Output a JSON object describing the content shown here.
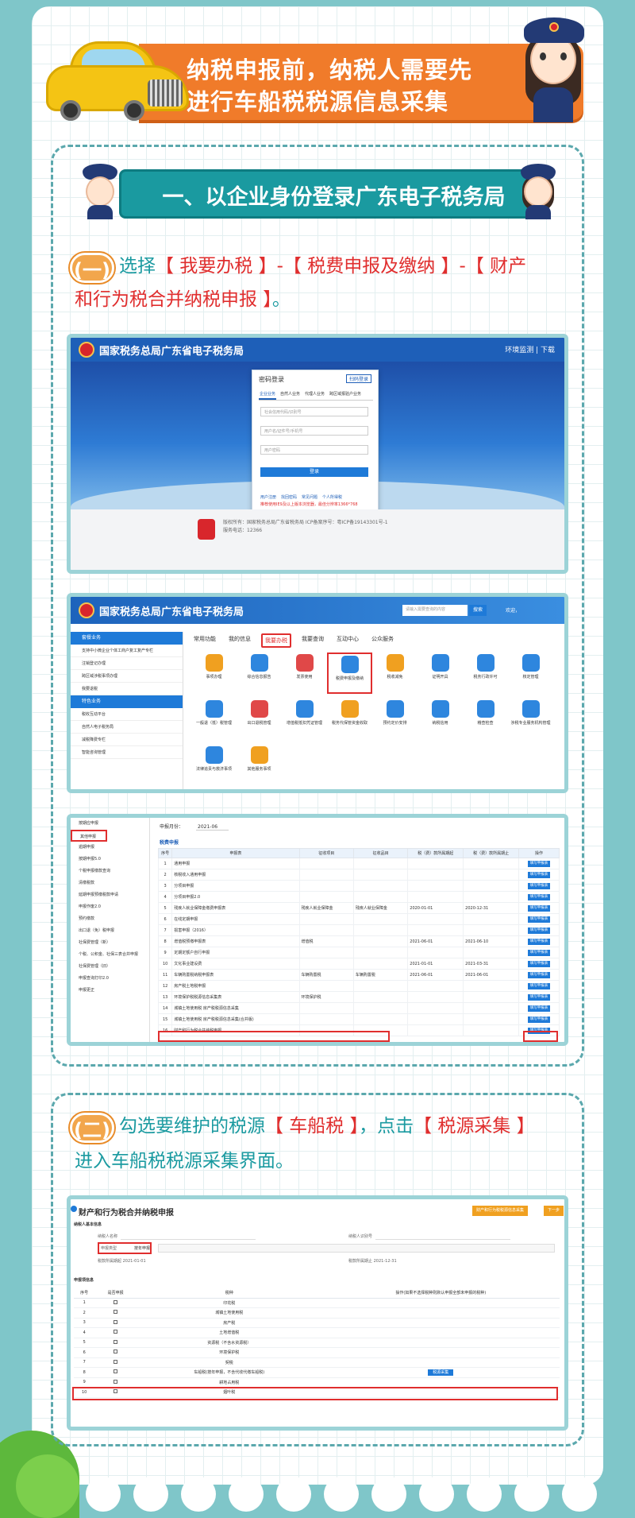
{
  "header": {
    "title_line1": "纳税申报前，纳税人需要先",
    "title_line2": "进行车船税税源信息采集"
  },
  "section1": {
    "title": "一、以企业身份登录广东电子税务局",
    "step_badge": "(一)",
    "step_line1_prefix": "选择",
    "step_line1_red": "【 我要办税 】-【 税费申报及缴纳 】-【 财产",
    "step_line2_red": "和行为税合并纳税申报 】",
    "step_line2_suffix": "。"
  },
  "shot1": {
    "site_title": "国家税务总局广东省电子税务局",
    "top_right": "环境监测  |  下载",
    "login_title": "密码登录",
    "login_other": "扫码登录",
    "tabs": [
      "企业业务",
      "自然人业务",
      "代理人业务",
      "跨区域报验户业务"
    ],
    "field_tax_id": "社会信用代码/识别号",
    "field_user": "用户名/证件号/手机号",
    "field_password": "用户密码",
    "login_button": "登录",
    "links": [
      "用户注册",
      "找回密码",
      "常见问题",
      "个人所得税"
    ],
    "warning": "推荐使用IE9及以上版本浏览器，最佳分辨率1366*768",
    "footer_line1": "版权所有：国家税务总局广东省税务局    ICP备案序号：粤ICP备19143301号-1",
    "footer_line2": "服务电话：12366"
  },
  "shot2": {
    "site_title": "国家税务总局广东省电子税务局",
    "search_placeholder": "请输入需要查询的内容",
    "search_button": "搜索",
    "user": "欢迎，",
    "tabs": [
      "常用功能",
      "我的信息",
      "我要办税",
      "我要查询",
      "互动中心",
      "公众服务"
    ],
    "side_head1": "套餐业务",
    "side_items1": [
      "支持中小微企业个体工商户复工复产专栏",
      "注销登记办理",
      "跨区域涉税事项办理",
      "我要退税"
    ],
    "side_head2": "特色业务",
    "side_items2": [
      "税收互动平台",
      "自然人电子税务局",
      "减税降费专栏",
      "智能咨询管理"
    ],
    "grid": [
      "事项办理",
      "综合信息报告",
      "发票使用",
      "税费申报及缴纳",
      "税收减免",
      "证明开具",
      "税务行政许可",
      "核定管理",
      "一般退（抵）税管理",
      "出口退税管理",
      "增值税抵扣凭证管理",
      "税务代保管资金收取",
      "预约定价安排",
      "纳税信用",
      "稽查检查",
      "涉税专业服务机构管理",
      "法律追责与救济事项",
      "其他服务事项"
    ]
  },
  "shot3": {
    "side_items": [
      "按期应申报",
      "其他申报",
      "逾期申报",
      "按期申报5.0",
      "个税申报缴款查询",
      "清缴税款",
      "延期申报预缴税款申请",
      "申报作废2.0",
      "预约缴款",
      "出口退（免）税申报",
      "社保费管理（新）",
      "个税、公积金、社保三表合并申报",
      "社保费管理（旧）",
      "申报查询打印2.0",
      "申报更正"
    ],
    "month_label": "申报月份：",
    "month_value": "2021-06",
    "table_label": "税费申报",
    "headers": [
      "序号",
      "申报表",
      "征收项目",
      "征收品目",
      "税（费）款所属期起",
      "税（费）款所属期止",
      "操作"
    ],
    "rows": [
      [
        "1",
        "通用申报",
        "",
        "",
        "",
        "",
        "填写申报表"
      ],
      [
        "2",
        "核税收入通用申报",
        "",
        "",
        "",
        "",
        "填写申报表"
      ],
      [
        "3",
        "分项目申报",
        "",
        "",
        "",
        "",
        "填写申报表"
      ],
      [
        "4",
        "分项目申报2.0",
        "",
        "",
        "",
        "",
        "填写申报表"
      ],
      [
        "5",
        "残疾人就业保障金缴费申报表",
        "残疾人就业保障金",
        "残疾人就业保障金",
        "2020-01-01",
        "2020-12-31",
        "填写申报表"
      ],
      [
        "6",
        "在线定期申报",
        "",
        "",
        "",
        "",
        "填写申报表"
      ],
      [
        "7",
        "损害申报（2016）",
        "",
        "",
        "",
        "",
        "填写申报表"
      ],
      [
        "8",
        "增值税预缴申报表",
        "增值税",
        "",
        "2021-06-01",
        "2021-06-10",
        "填写申报表"
      ],
      [
        "9",
        "定期定额户自行申报",
        "",
        "",
        "",
        "",
        "填写申报表"
      ],
      [
        "10",
        "文化事业建设费",
        "",
        "",
        "2021-01-01",
        "2021-03-31",
        "填写申报表"
      ],
      [
        "11",
        "车辆购置税纳税申报表",
        "车辆购置税",
        "车辆购置税",
        "2021-06-01",
        "2021-06-01",
        "填写申报表"
      ],
      [
        "12",
        "房产税土地税申报",
        "",
        "",
        "",
        "",
        "填写申报表"
      ],
      [
        "13",
        "环境保护税税源信息采集表",
        "环境保护税",
        "",
        "",
        "",
        "填写申报表"
      ],
      [
        "14",
        "城镇土地使用税 房产税税源信息采集",
        "",
        "",
        "",
        "",
        "填写申报表"
      ],
      [
        "15",
        "城镇土地使用税 房产税税源信息采集(合并版)",
        "",
        "",
        "",
        "",
        "填写申报表"
      ],
      [
        "16",
        "财产和行为税合并纳税申报",
        "",
        "",
        "",
        "",
        "填写申报表"
      ]
    ]
  },
  "section2": {
    "step_badge": "(二)",
    "step_line1_prefix": "勾选要维护的税源",
    "step_line1_red1": "【 车船税 】",
    "step_line1_mid": "，点击",
    "step_line1_red2": "【 税源采集 】",
    "step_line2": "进入车船税税源采集界面。"
  },
  "shot4": {
    "title": "财产和行为税合并纳税申报",
    "orange_btn1": "财产和行为税税源信息采集",
    "orange_btn2": "下一步",
    "basic_info": "纳税人基本信息",
    "k_name": "纳税人名称",
    "k_id": "纳税人识别号",
    "k_type": "申报类型",
    "v_type": "按年申报",
    "k_start": "税款所属期起",
    "v_start": "2021-01-01",
    "k_end": "税款所属期止",
    "v_end": "2021-12-31",
    "table_info": "申报项信息",
    "headers": [
      "序号",
      "是否申报",
      "税种",
      "操作(如果不选择税种则默认申报全部未申报的税种)"
    ],
    "rows": [
      [
        "1",
        "印花税",
        ""
      ],
      [
        "2",
        "城镇土地使用税",
        ""
      ],
      [
        "3",
        "房产税",
        ""
      ],
      [
        "4",
        "土地增值税",
        ""
      ],
      [
        "5",
        "资源税（不含水资源税）",
        ""
      ],
      [
        "6",
        "环境保护税",
        ""
      ],
      [
        "7",
        "契税",
        ""
      ],
      [
        "8",
        "车船税(按年申报，不含代收代缴车船税)",
        "税源采集"
      ],
      [
        "9",
        "耕地占用税",
        ""
      ],
      [
        "10",
        "烟叶税",
        ""
      ]
    ]
  }
}
